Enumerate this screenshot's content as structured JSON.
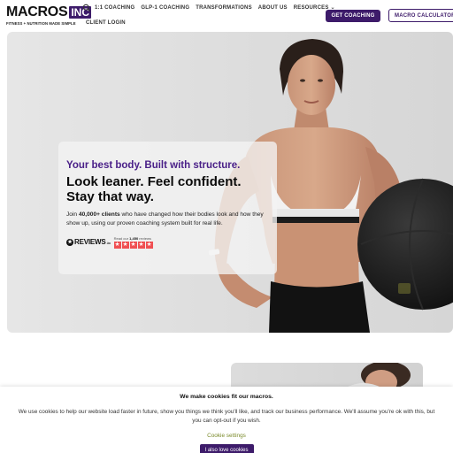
{
  "logo": {
    "text": "MACROS",
    "badge": "INC",
    "tagline": "FITNESS + NUTRITION MADE SIMPLE"
  },
  "header": {
    "search_icon": "search-icon",
    "nav": [
      {
        "label": "1:1 COACHING"
      },
      {
        "label": "GLP-1 COACHING"
      },
      {
        "label": "TRANSFORMATIONS"
      },
      {
        "label": "ABOUT US"
      },
      {
        "label": "RESOURCES"
      }
    ],
    "nav_row2": "CLIENT LOGIN",
    "cta_primary": "GET COACHING",
    "cta_secondary": "MACRO CALCULATOR"
  },
  "hero": {
    "tagline": "Your best body. Built with structure.",
    "title_line1": "Look leaner. Feel confident.",
    "title_line2": "Stay that way.",
    "desc_prefix": "Join ",
    "desc_bold": "40,000+ clients",
    "desc_suffix": " who have changed how their bodies look and how they show up, using our proven coaching system built for real life.",
    "reviews_brand": "REVIEWS",
    "reviews_brand_suffix": ".io",
    "reviews_read_prefix": "Read our ",
    "reviews_count": "1,450",
    "reviews_read_suffix": " reviews",
    "rating": 5
  },
  "cookie": {
    "title": "We make cookies fit our macros.",
    "text_line1": "We use cookies to help our website load faster in future, show you things we think you'll like, and track our business performance. We'll assume you're ok with this, but",
    "text_line2": "you can opt-out if you wish.",
    "settings_link": "Cookie settings",
    "accept_button": "I also love cookies"
  },
  "colors": {
    "brand_purple": "#3d1b6a",
    "tagline_purple": "#4a2088",
    "star_red": "#f04f52"
  }
}
